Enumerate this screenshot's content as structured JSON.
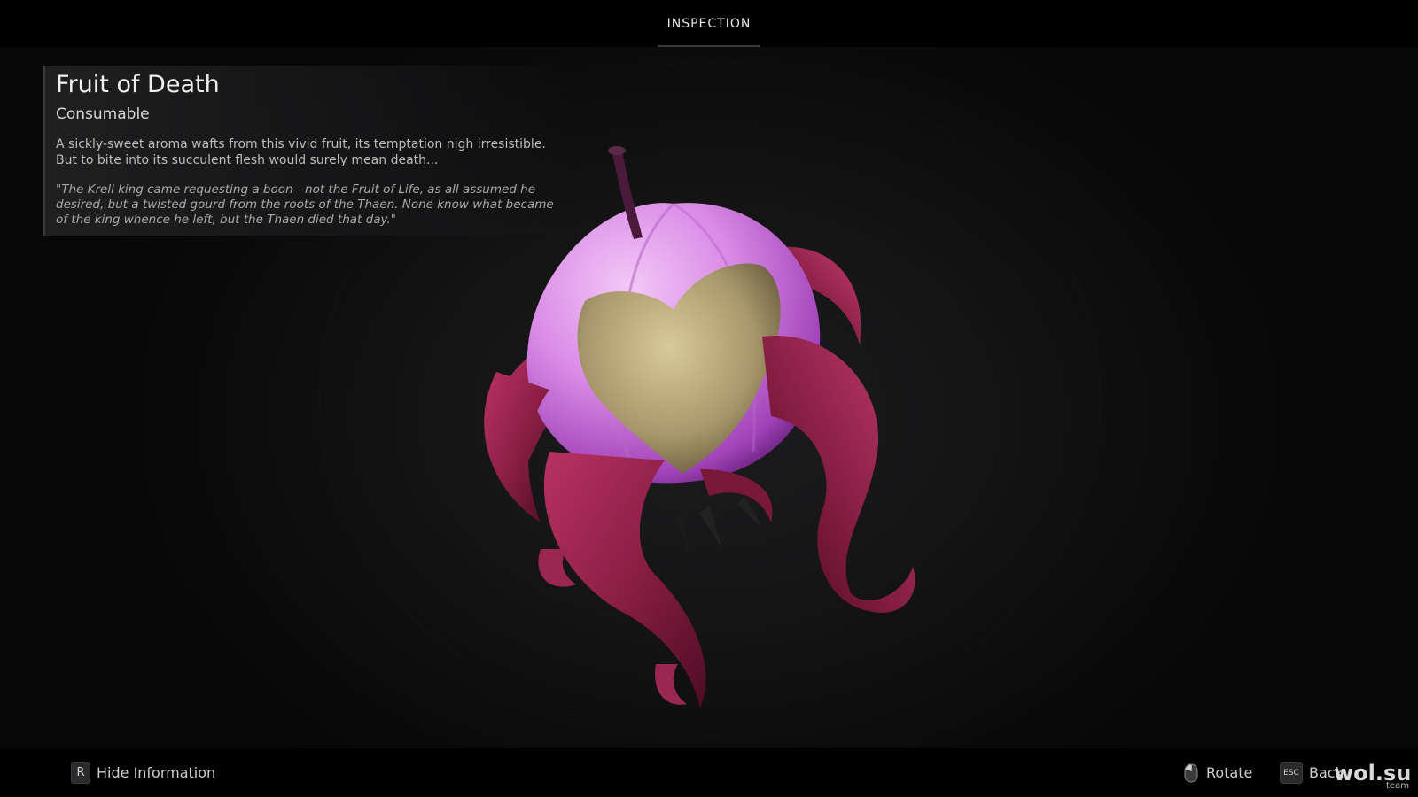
{
  "topbar": {
    "tab_label": "INSPECTION"
  },
  "item": {
    "name": "Fruit of Death",
    "type": "Consumable",
    "description": [
      "A sickly-sweet aroma wafts from this vivid fruit, its temptation nigh irresistible.",
      "But to bite into its succulent flesh would surely mean death..."
    ],
    "lore": [
      "\"The Krell king came requesting a boon—not the Fruit of Life, as all assumed he",
      "desired, but a twisted gourd from the roots of the Thaen. None know what became",
      "of the king whence he left, but the Thaen died that day.\""
    ]
  },
  "controls": {
    "hide_info": {
      "key": "R",
      "label": "Hide Information"
    },
    "rotate": {
      "icon": "mouse-icon",
      "label": "Rotate"
    },
    "back": {
      "key": "ESC",
      "label": "Back"
    }
  },
  "watermark": {
    "text": "wol.su",
    "sub": "team"
  },
  "colors": {
    "fruit_skin": "#d98ae6",
    "fruit_flesh": "#b9a878",
    "leaves": "#8c1f45"
  }
}
